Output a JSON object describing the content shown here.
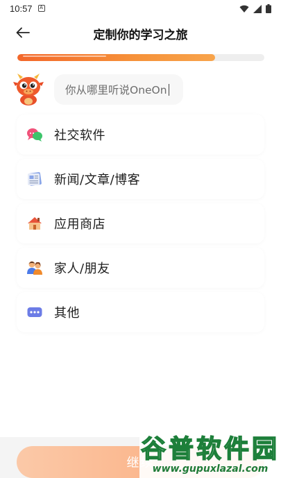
{
  "status_bar": {
    "time": "10:57",
    "notification_glyph": "A",
    "battery_icon": "battery-icon",
    "signal_icon": "signal-icon",
    "wifi_icon": "wifi-icon"
  },
  "header": {
    "title": "定制你的学习之旅",
    "back_icon": "back-arrow-icon"
  },
  "progress": {
    "fraction": 0.8,
    "fill_color": "#f6823a"
  },
  "mascot": {
    "icon": "dragon-mascot-icon"
  },
  "question": {
    "text": "你从哪里听说OneOn"
  },
  "options": [
    {
      "label": "社交软件",
      "icon": "chat-bubbles-icon"
    },
    {
      "label": "新闻/文章/博客",
      "icon": "newspaper-icon"
    },
    {
      "label": "应用商店",
      "icon": "house-icon"
    },
    {
      "label": "家人/朋友",
      "icon": "family-icon"
    },
    {
      "label": "其他",
      "icon": "more-dots-icon"
    }
  ],
  "continue_button": {
    "label": "继续"
  },
  "watermark": {
    "title": "谷普软件园",
    "url": "www.gupuxlazal.com"
  },
  "colors": {
    "accent": "#f6823a",
    "button": "#fbb88f",
    "watermark": "#1d7f3a"
  }
}
